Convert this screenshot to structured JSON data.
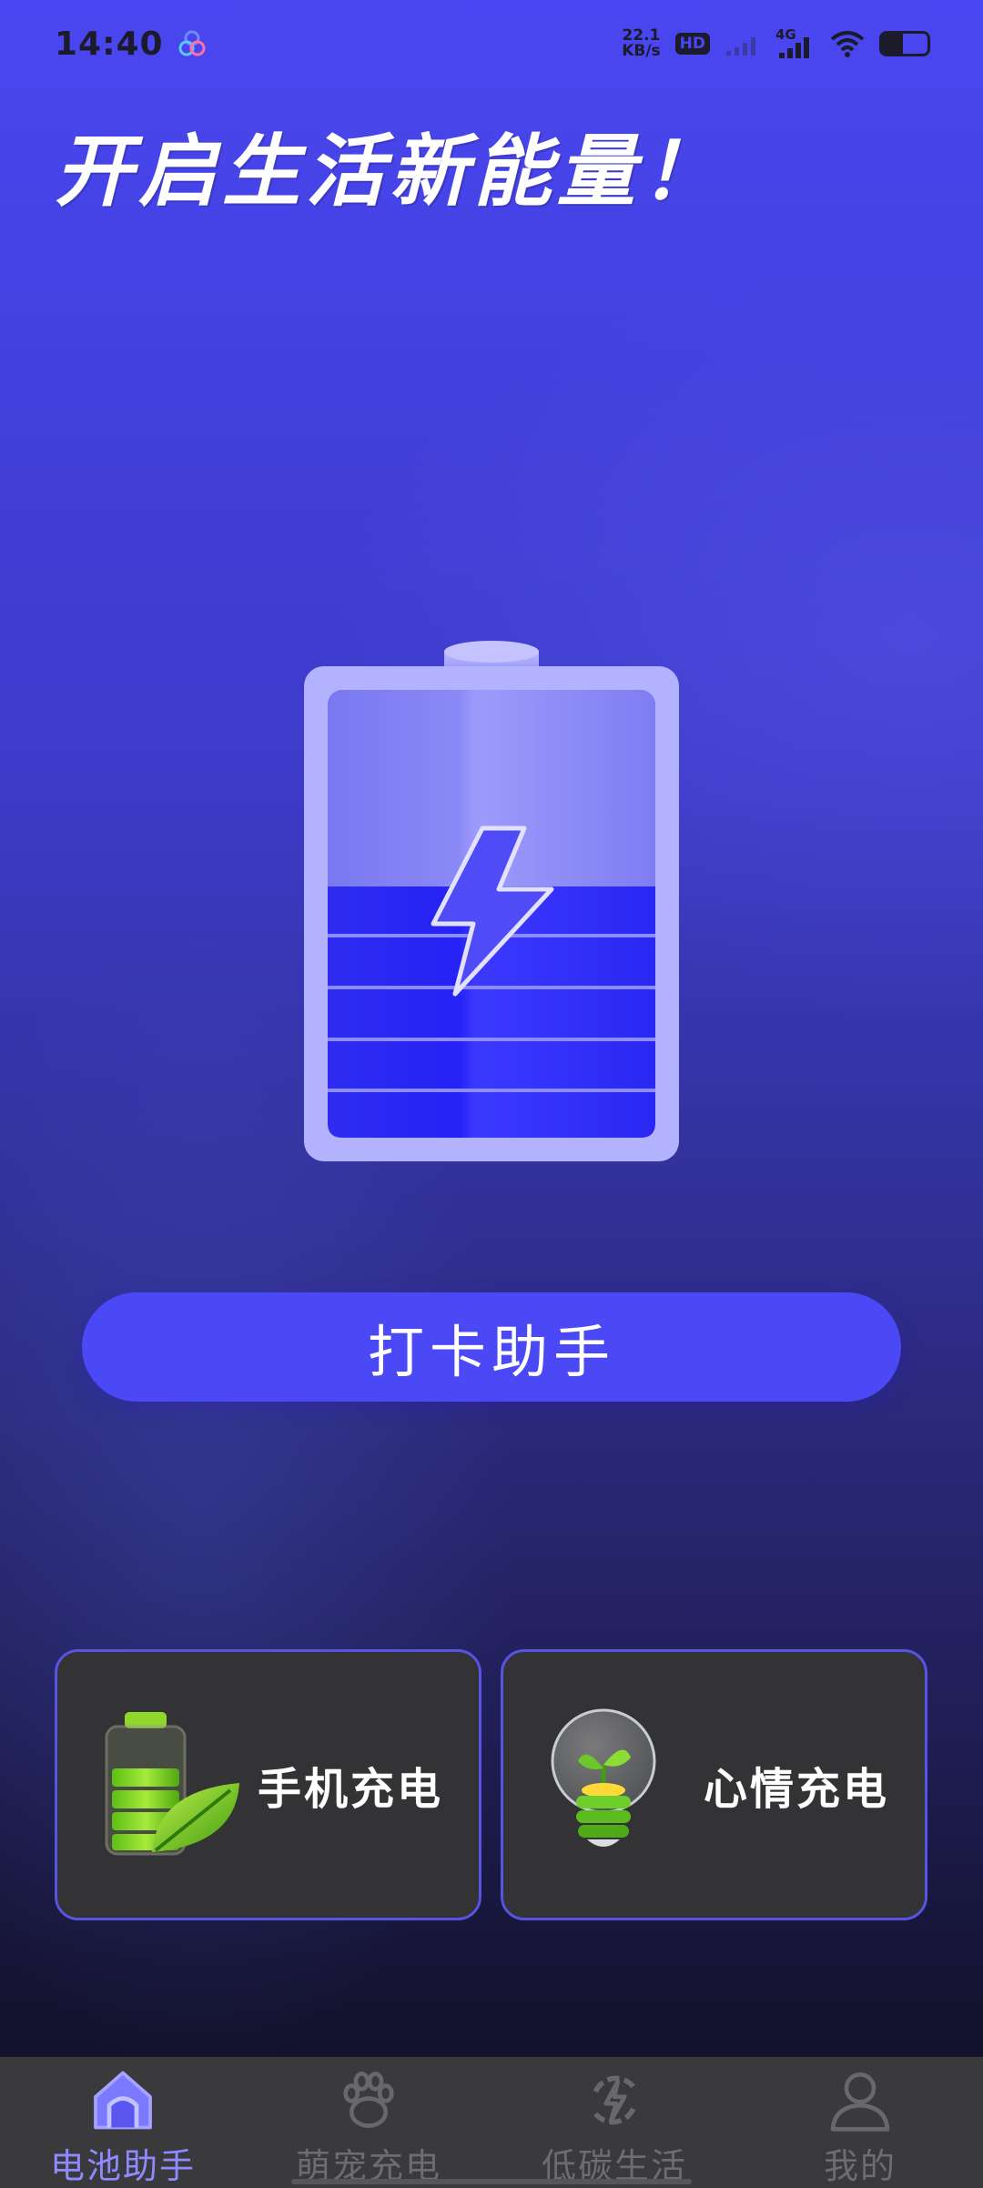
{
  "status_bar": {
    "time": "14:40",
    "net_speed_value": "22.1",
    "net_speed_unit": "KB/s",
    "hd": "HD",
    "network": "4G"
  },
  "headline": "开启生活新能量！",
  "checkin_button": {
    "label": "打卡助手"
  },
  "cards": [
    {
      "label": "手机充电",
      "icon": "battery-leaf-icon"
    },
    {
      "label": "心情充电",
      "icon": "lightbulb-plant-icon"
    }
  ],
  "nav": {
    "items": [
      {
        "label": "电池助手",
        "icon": "home-icon",
        "active": true
      },
      {
        "label": "萌宠充电",
        "icon": "paw-icon",
        "active": false
      },
      {
        "label": "低碳生活",
        "icon": "recycle-bolt-icon",
        "active": false
      },
      {
        "label": "我的",
        "icon": "user-icon",
        "active": false
      }
    ]
  },
  "colors": {
    "accent": "#4b48f6",
    "active_nav": "#8d8bff",
    "card_bg": "#333335",
    "card_border": "#5654e2"
  }
}
